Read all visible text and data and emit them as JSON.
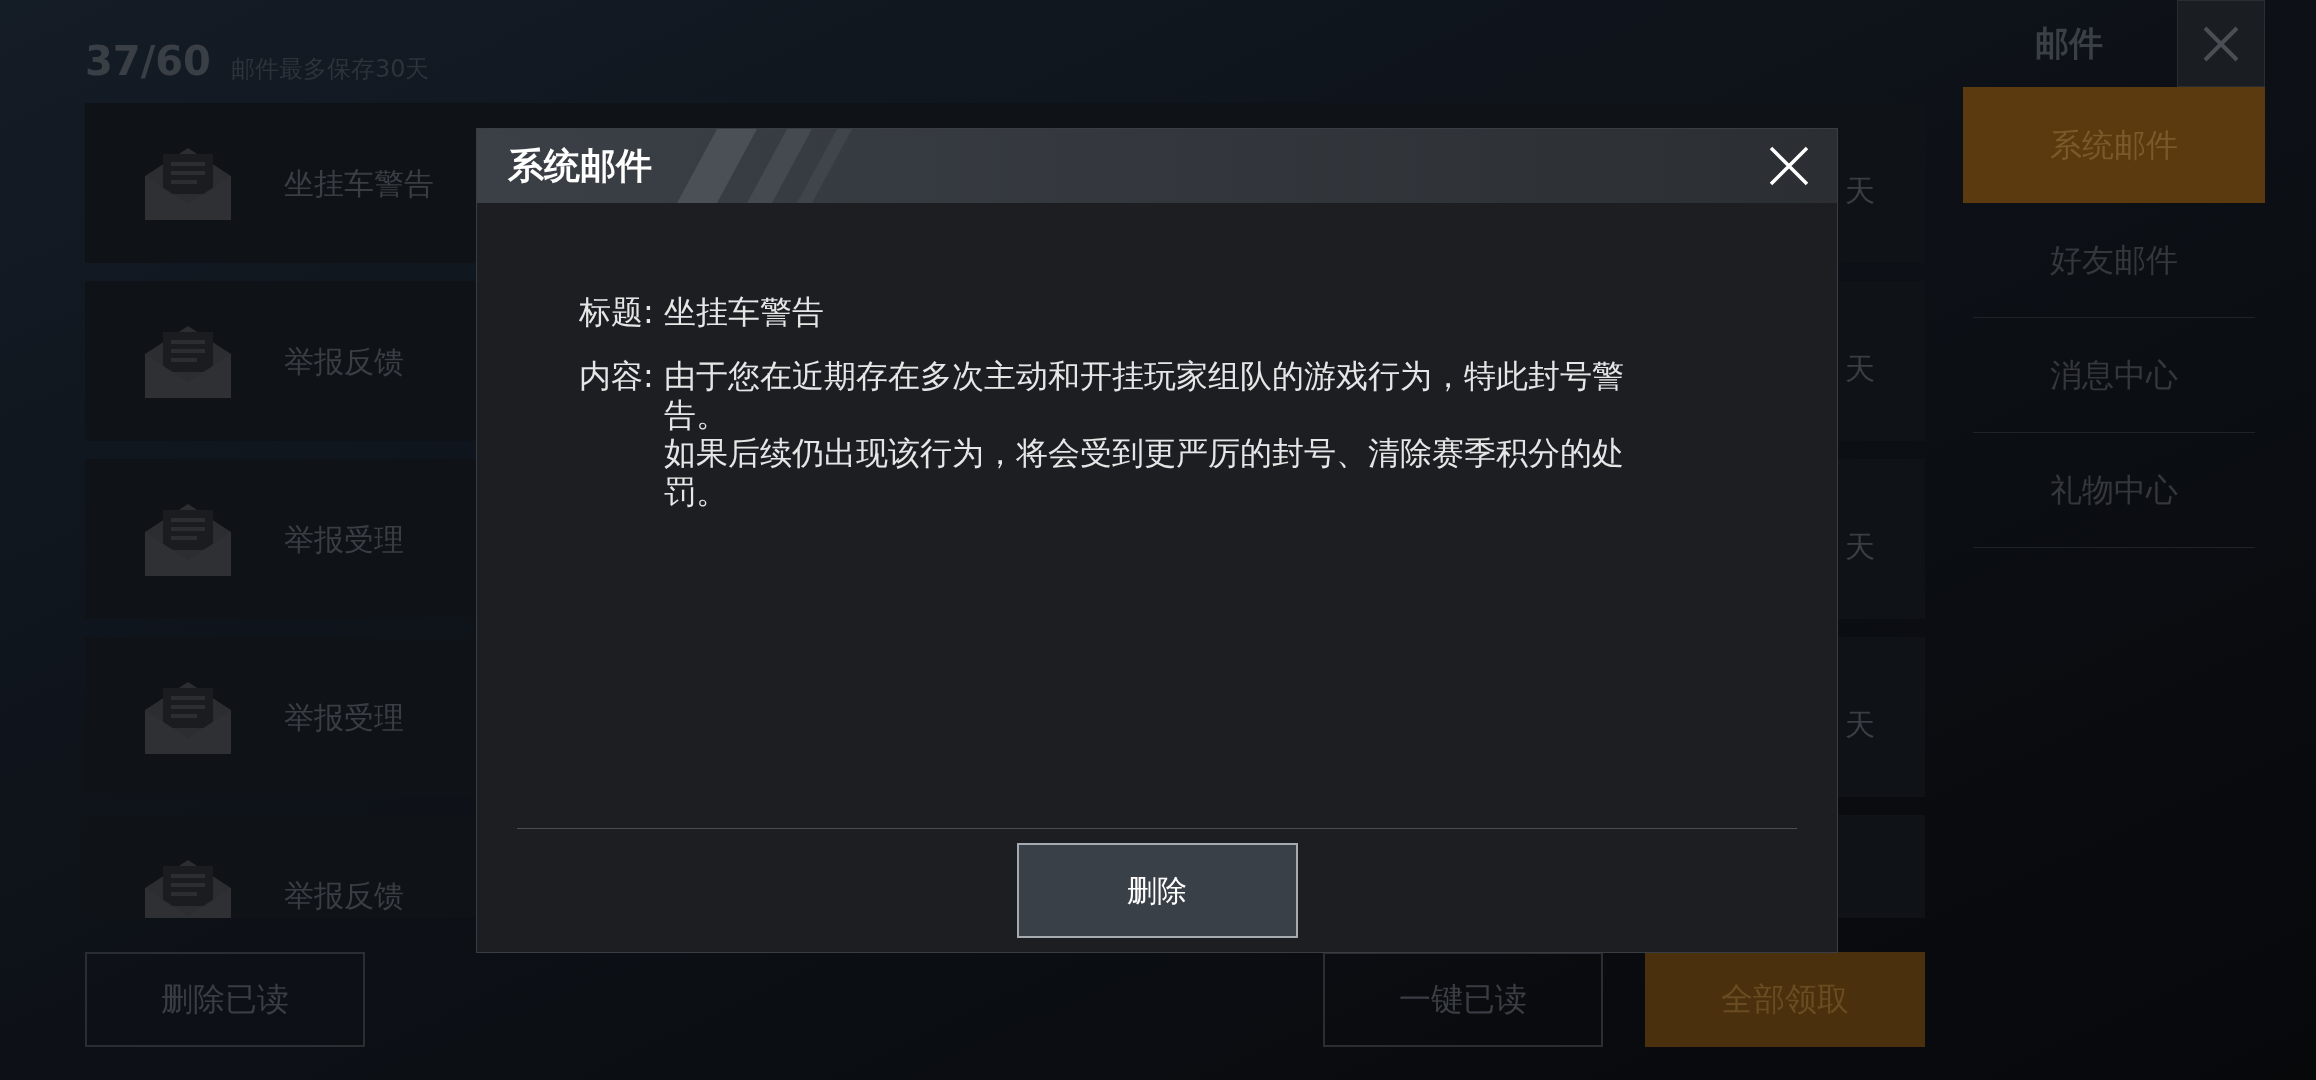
{
  "header": {
    "count": "37/60",
    "note": "邮件最多保存30天"
  },
  "mails": [
    {
      "title": "坐挂车警告",
      "expiry": "天"
    },
    {
      "title": "举报反馈",
      "expiry": "天"
    },
    {
      "title": "举报受理",
      "expiry": "天"
    },
    {
      "title": "举报受理",
      "expiry": "天"
    },
    {
      "title": "举报反馈"
    }
  ],
  "sidebar": {
    "title": "邮件",
    "tabs": [
      {
        "label": "系统邮件",
        "selected": true
      },
      {
        "label": "好友邮件",
        "selected": false
      },
      {
        "label": "消息中心",
        "selected": false
      },
      {
        "label": "礼物中心",
        "selected": false
      }
    ]
  },
  "bottom_buttons": [
    {
      "label": "删除已读",
      "kind": "secondary"
    },
    {
      "label": "一键已读",
      "kind": "secondary"
    },
    {
      "label": "全部领取",
      "kind": "primary"
    }
  ],
  "dialog": {
    "title": "系统邮件",
    "subject": {
      "label": "标题:",
      "value": "坐挂车警告"
    },
    "content": {
      "label": "内容:",
      "paragraphs": [
        "由于您在近期存在多次主动和开挂玩家组队的游戏行为，特此封号警告。",
        "如果后续仍出现该行为，将会受到更严厉的封号、清除赛季积分的处罚。"
      ]
    },
    "button": "删除"
  }
}
